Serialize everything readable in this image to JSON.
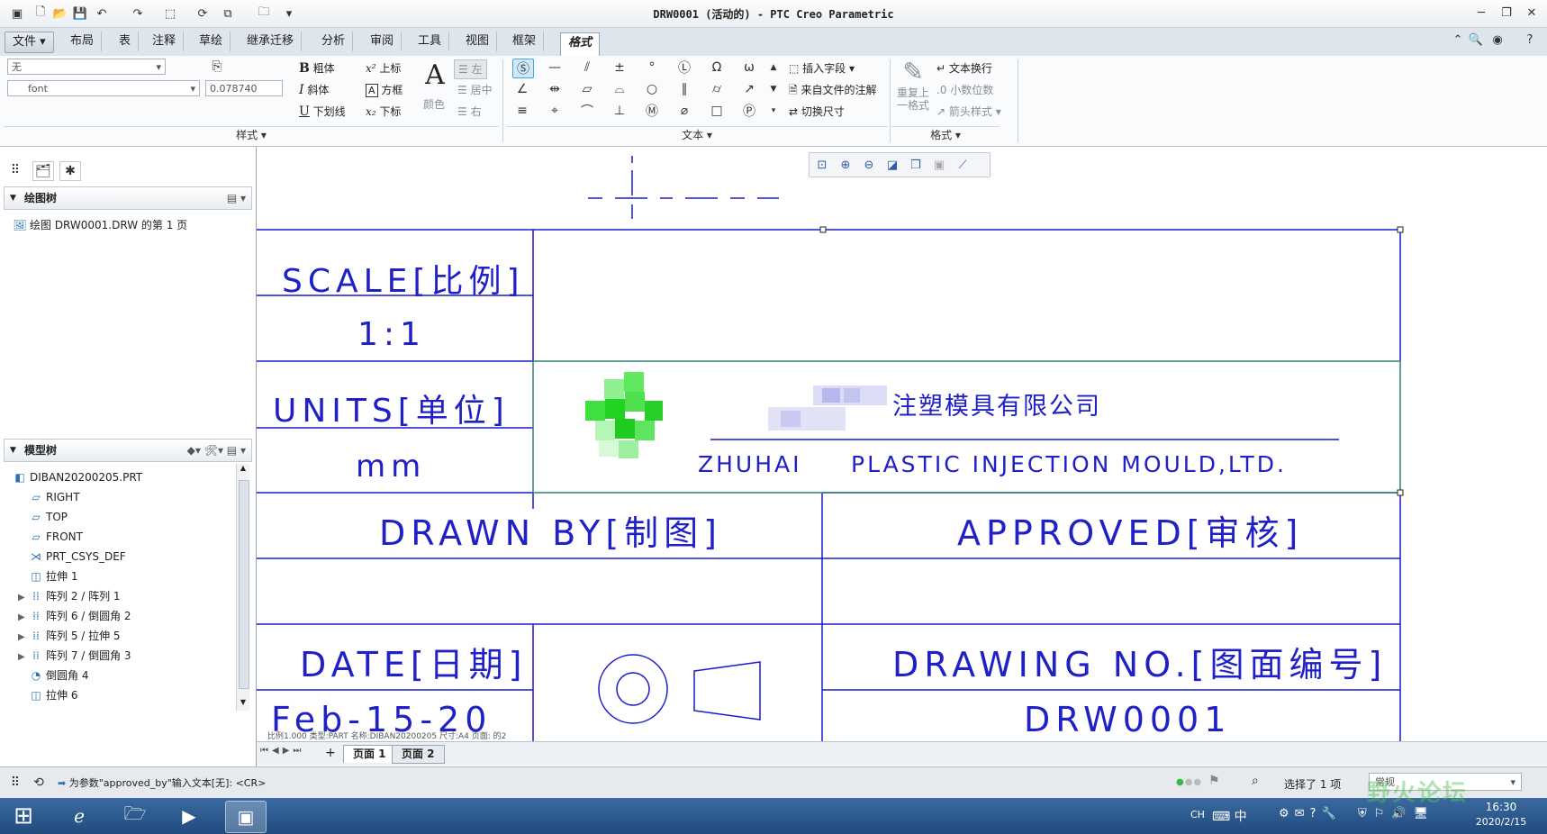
{
  "window": {
    "title": "DRW0001 (活动的) - PTC Creo Parametric"
  },
  "menu_tabs": [
    "文件",
    "布局",
    "表",
    "注释",
    "草绘",
    "继承迁移",
    "分析",
    "审阅",
    "工具",
    "视图",
    "框架",
    "格式"
  ],
  "ribbon": {
    "style_group": {
      "label": "样式",
      "style_select": "无",
      "font_select": "font",
      "height_value": "0.078740",
      "bold": "粗体",
      "italic": "斜体",
      "underline": "下划线",
      "superscript": "上标",
      "box": "方框",
      "subscript": "下标",
      "color": "颜色",
      "align_left": "左",
      "align_center": "居中",
      "align_right": "右"
    },
    "text_group": {
      "label": "文本",
      "insert_field": "插入字段",
      "from_file_note": "来自文件的注解",
      "toggle_dimension": "切换尺寸"
    },
    "format_group": {
      "label": "格式",
      "repeat_last_format": "重复上一格式",
      "text_wrap": "文本换行",
      "decimal_places": "小数位数",
      "arrow_style": "箭头样式"
    }
  },
  "drawing_tree": {
    "title": "绘图树",
    "items": [
      "绘图 DRW0001.DRW 的第 1 页"
    ]
  },
  "model_tree": {
    "title": "模型树",
    "items": [
      {
        "label": "DIBAN20200205.PRT",
        "icon": "part-icon",
        "expandable": false
      },
      {
        "label": "RIGHT",
        "icon": "datum-plane-icon",
        "expandable": false
      },
      {
        "label": "TOP",
        "icon": "datum-plane-icon",
        "expandable": false
      },
      {
        "label": "FRONT",
        "icon": "datum-plane-icon",
        "expandable": false
      },
      {
        "label": "PRT_CSYS_DEF",
        "icon": "csys-icon",
        "expandable": false
      },
      {
        "label": "拉伸 1",
        "icon": "extrude-icon",
        "expandable": false
      },
      {
        "label": "阵列 2 / 阵列 1",
        "icon": "pattern-icon",
        "expandable": true
      },
      {
        "label": "阵列 6 / 倒圆角 2",
        "icon": "pattern-icon",
        "expandable": true
      },
      {
        "label": "阵列 5 / 拉伸 5",
        "icon": "pattern-icon",
        "expandable": true
      },
      {
        "label": "阵列 7 / 倒圆角 3",
        "icon": "pattern-icon",
        "expandable": true
      },
      {
        "label": "倒圆角 4",
        "icon": "round-icon",
        "expandable": false
      },
      {
        "label": "拉伸 6",
        "icon": "extrude-icon",
        "expandable": false
      }
    ]
  },
  "title_block": {
    "scale_label": "SCALE[比例]",
    "scale_value": "1:1",
    "units_label": "UNITS[单位]",
    "units_value": "mm",
    "company_cn": "注塑模具有限公司",
    "company_en_prefix": "ZHUHAI",
    "company_en": "PLASTIC INJECTION MOULD,LTD.",
    "drawn_by_label": "DRAWN BY[制图]",
    "approved_label": "APPROVED[审核]",
    "date_label": "DATE[日期]",
    "date_value": "Feb-15-20",
    "drawing_no_label": "DRAWING NO.[图面编号]",
    "drawing_no_value": "DRW0001"
  },
  "page_info": "比例1.000   类型:PART   名称:DIBAN20200205   尺寸:A4   页面:  的2",
  "page_tabs": [
    "页面 1",
    "页面 2"
  ],
  "status": {
    "message": "为参数\"approved_by\"输入文本[无]:  <CR>",
    "selection": "选择了 1 项",
    "filter": "常规"
  },
  "taskbar": {
    "lang": "CH",
    "ime": "中",
    "time": "16:30",
    "date": "2020/2/15"
  },
  "watermark": "野火论坛",
  "colors": {
    "drawing_blue": "#2020c8",
    "selection_green": "#3cb44b"
  }
}
